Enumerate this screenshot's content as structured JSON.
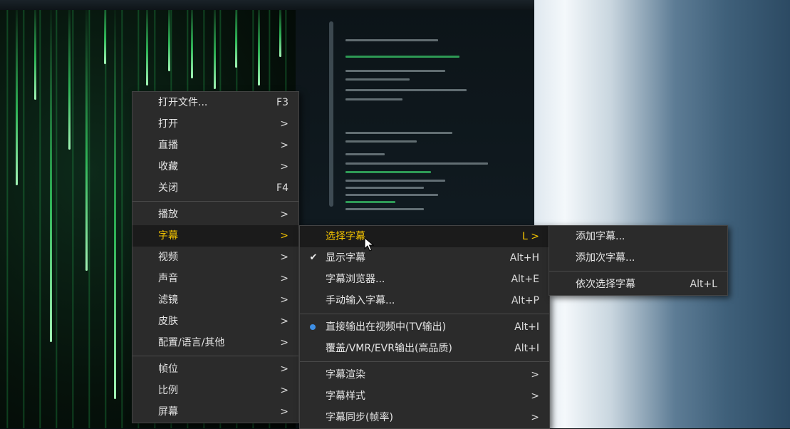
{
  "menu_main": {
    "groups": [
      [
        {
          "label": "打开文件...",
          "shortcut": "F3"
        },
        {
          "label": "打开",
          "shortcut": ">"
        },
        {
          "label": "直播",
          "shortcut": ">"
        },
        {
          "label": "收藏",
          "shortcut": ">"
        },
        {
          "label": "关闭",
          "shortcut": "F4"
        }
      ],
      [
        {
          "label": "播放",
          "shortcut": ">"
        },
        {
          "label": "字幕",
          "shortcut": ">"
        },
        {
          "label": "视频",
          "shortcut": ">"
        },
        {
          "label": "声音",
          "shortcut": ">"
        },
        {
          "label": "滤镜",
          "shortcut": ">"
        },
        {
          "label": "皮肤",
          "shortcut": ">"
        },
        {
          "label": "配置/语言/其他",
          "shortcut": ">"
        }
      ],
      [
        {
          "label": "帧位",
          "shortcut": ">"
        },
        {
          "label": "比例",
          "shortcut": ">"
        },
        {
          "label": "屏幕",
          "shortcut": ">"
        }
      ]
    ]
  },
  "menu_subtitle": {
    "groups": [
      [
        {
          "label": "选择字幕",
          "shortcut": "L >"
        },
        {
          "label": "显示字幕",
          "shortcut": "Alt+H",
          "marker": "✔"
        },
        {
          "label": "字幕浏览器...",
          "shortcut": "Alt+E"
        },
        {
          "label": "手动输入字幕...",
          "shortcut": "Alt+P"
        }
      ],
      [
        {
          "label": "直接输出在视频中(TV输出)",
          "shortcut": "Alt+I"
        },
        {
          "label": "覆盖/VMR/EVR输出(高品质)",
          "shortcut": "Alt+I"
        }
      ],
      [
        {
          "label": "字幕渲染",
          "shortcut": ">"
        },
        {
          "label": "字幕样式",
          "shortcut": ">"
        },
        {
          "label": "字幕同步(帧率)",
          "shortcut": ">"
        }
      ]
    ]
  },
  "menu_select_subtitle": {
    "groups": [
      [
        {
          "label": "添加字幕..."
        },
        {
          "label": "添加次字幕..."
        }
      ],
      [
        {
          "label": "依次选择字幕",
          "shortcut": "Alt+L"
        }
      ]
    ]
  },
  "colors": {
    "menu_bg": "#2b2b2b",
    "highlight_text": "#f2c200",
    "highlight_bg": "#1b1b1b",
    "radio_dot": "#3e8fe6"
  }
}
